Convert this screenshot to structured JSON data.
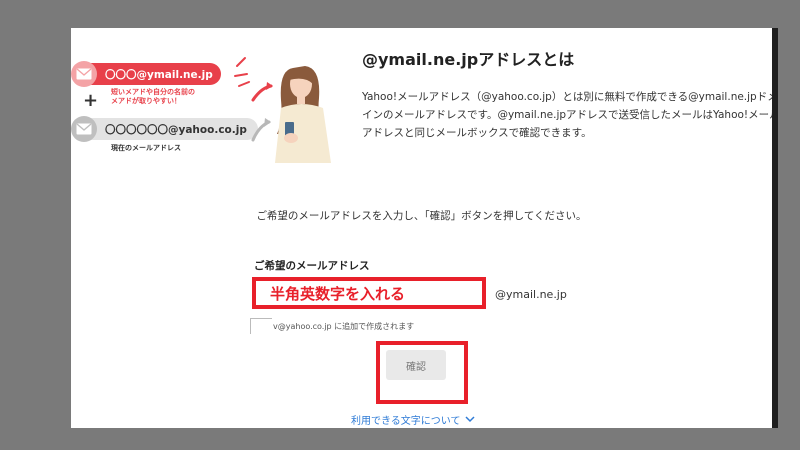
{
  "illustration": {
    "new_address": "〇〇〇@ymail.ne.jp",
    "new_address_note_line1": "短いメアドや自分の名前の",
    "new_address_note_line2": "メアドが取りやすい！",
    "plus": "+",
    "current_address": "〇〇〇〇〇〇@yahoo.co.jp",
    "current_address_note": "現在のメールアドレス"
  },
  "header": {
    "title": "@ymail.ne.jpアドレスとは",
    "description": "Yahoo!メールアドレス（@yahoo.co.jp）とは別に無料で作成できる@ymail.ne.jpドメインのメールアドレスです。@ymail.ne.jpアドレスで送受信したメールはYahoo!メールアドレスと同じメールボックスで確認できます。"
  },
  "instruction": "ご希望のメールアドレスを入力し、「確認」ボタンを押してください。",
  "form": {
    "label": "ご希望のメールアドレス",
    "input_annotation": "半角英数字を入れる",
    "domain_suffix": "@ymail.ne.jp",
    "hint": "v@yahoo.co.jp に追加で作成されます",
    "confirm_label": "確認"
  },
  "help_link": "利用できる文字について",
  "colors": {
    "accent_red": "#e8202a",
    "pill_red": "#e8404a",
    "link_blue": "#2f7bd6",
    "background_gray": "#7a7a7a"
  }
}
